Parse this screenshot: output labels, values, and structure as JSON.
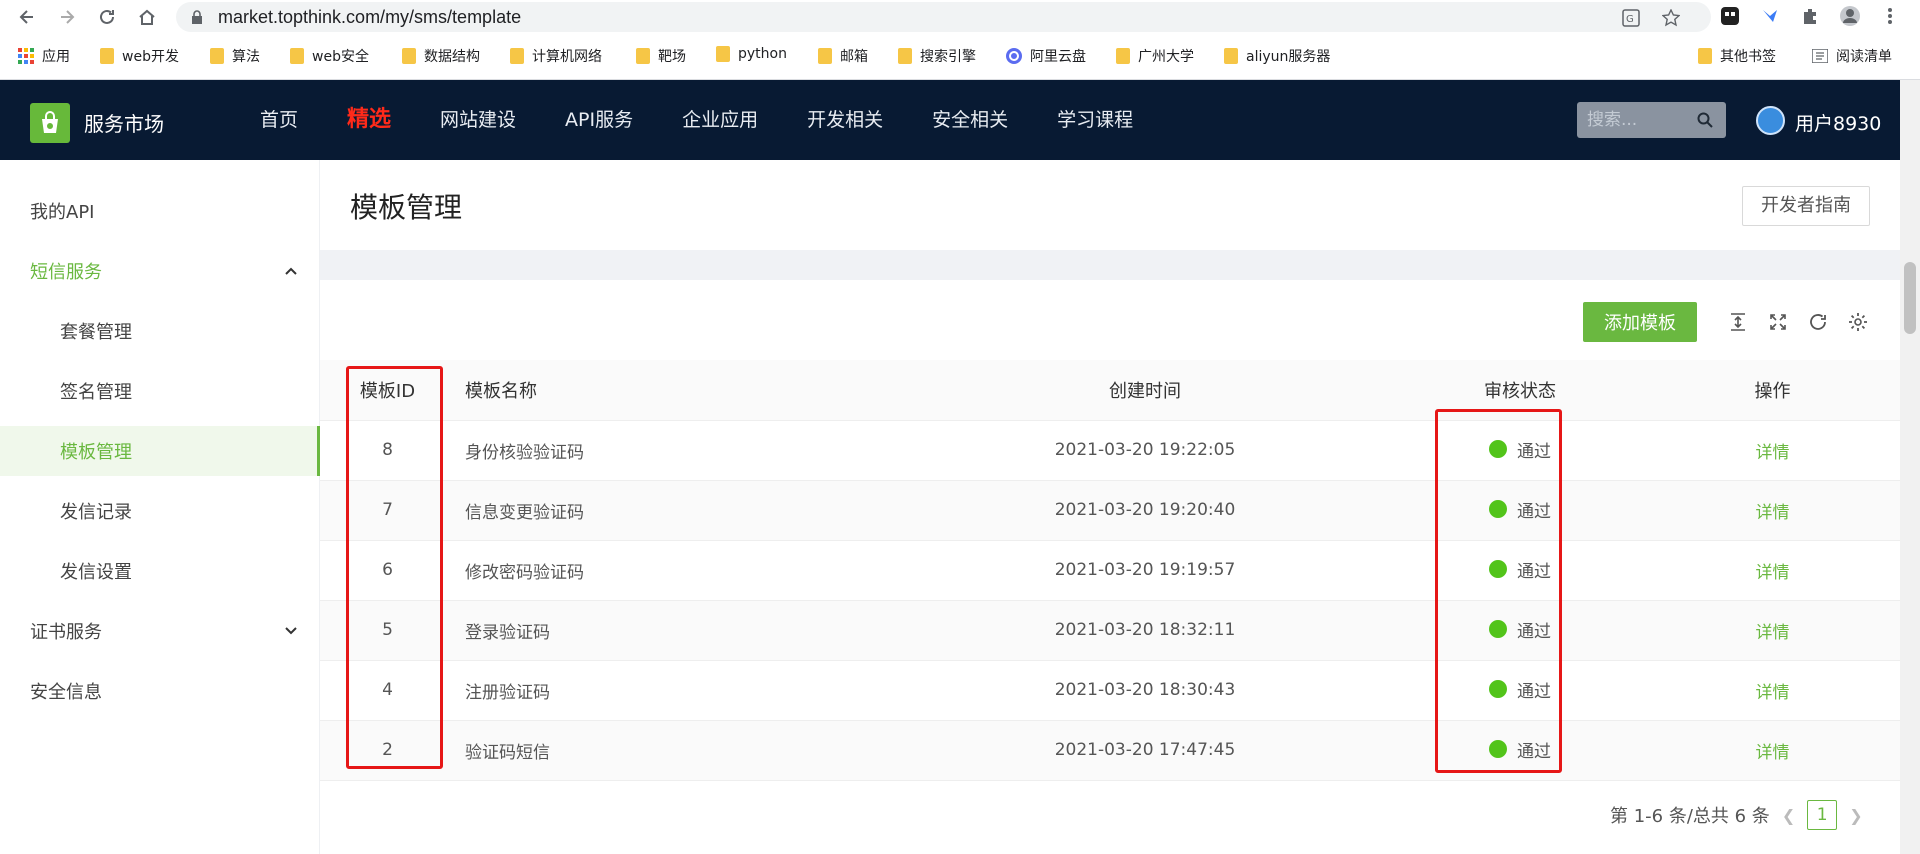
{
  "browser": {
    "url": "market.topthink.com/my/sms/template",
    "bookmarks": [
      {
        "label": "应用",
        "type": "apps"
      },
      {
        "label": "web开发",
        "type": "folder"
      },
      {
        "label": "算法",
        "type": "folder"
      },
      {
        "label": "web安全",
        "type": "folder"
      },
      {
        "label": "数据结构",
        "type": "folder"
      },
      {
        "label": "计算机网络",
        "type": "folder"
      },
      {
        "label": "靶场",
        "type": "folder"
      },
      {
        "label": "python",
        "type": "folder"
      },
      {
        "label": "邮箱",
        "type": "folder"
      },
      {
        "label": "搜索引擎",
        "type": "folder"
      },
      {
        "label": "阿里云盘",
        "type": "site"
      },
      {
        "label": "广州大学",
        "type": "folder"
      },
      {
        "label": "aliyun服务器",
        "type": "folder"
      }
    ],
    "bookmarks_right": {
      "other": "其他书签",
      "reading_list": "阅读清单"
    }
  },
  "header": {
    "brand": "服务市场",
    "nav": [
      {
        "label": "首页"
      },
      {
        "label": "精选",
        "featured": true
      },
      {
        "label": "网站建设"
      },
      {
        "label": "API服务"
      },
      {
        "label": "企业应用"
      },
      {
        "label": "开发相关"
      },
      {
        "label": "安全相关"
      },
      {
        "label": "学习课程"
      }
    ],
    "search_placeholder": "搜索...",
    "username": "用户8930"
  },
  "sidebar": {
    "items": [
      {
        "label": "我的API",
        "level": 0
      },
      {
        "label": "短信服务",
        "level": 0,
        "expanded": true
      },
      {
        "label": "套餐管理",
        "level": 1
      },
      {
        "label": "签名管理",
        "level": 1
      },
      {
        "label": "模板管理",
        "level": 1,
        "active": true
      },
      {
        "label": "发信记录",
        "level": 1
      },
      {
        "label": "发信设置",
        "level": 1
      },
      {
        "label": "证书服务",
        "level": 0,
        "expanded": false
      },
      {
        "label": "安全信息",
        "level": 0
      }
    ]
  },
  "main": {
    "title": "模板管理",
    "dev_guide": "开发者指南",
    "add_button": "添加模板",
    "table": {
      "columns": [
        "模板ID",
        "模板名称",
        "创建时间",
        "审核状态",
        "操作"
      ],
      "rows": [
        {
          "id": "8",
          "name": "身份核验验证码",
          "time": "2021-03-20 19:22:05",
          "status": "通过",
          "action": "详情"
        },
        {
          "id": "7",
          "name": "信息变更验证码",
          "time": "2021-03-20 19:20:40",
          "status": "通过",
          "action": "详情"
        },
        {
          "id": "6",
          "name": "修改密码验证码",
          "time": "2021-03-20 19:19:57",
          "status": "通过",
          "action": "详情"
        },
        {
          "id": "5",
          "name": "登录验证码",
          "time": "2021-03-20 18:32:11",
          "status": "通过",
          "action": "详情"
        },
        {
          "id": "4",
          "name": "注册验证码",
          "time": "2021-03-20 18:30:43",
          "status": "通过",
          "action": "详情"
        },
        {
          "id": "2",
          "name": "验证码短信",
          "time": "2021-03-20 17:47:45",
          "status": "通过",
          "action": "详情"
        }
      ]
    },
    "pagination": {
      "summary": "第 1-6 条/总共 6 条",
      "current": "1"
    }
  },
  "colors": {
    "accent": "#6ab840",
    "header_bg": "#081a33",
    "featured": "#ff2a1a",
    "status_ok": "#52c41a",
    "highlight": "#e61717"
  }
}
